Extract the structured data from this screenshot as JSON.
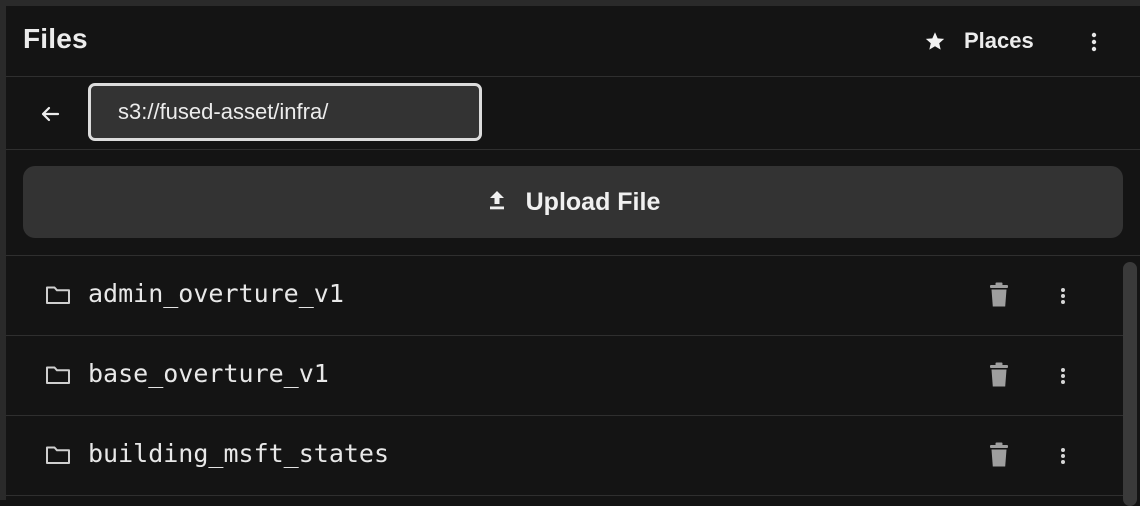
{
  "header": {
    "title": "Files",
    "places_label": "Places"
  },
  "pathbar": {
    "path_value": "s3://fused-asset/infra/"
  },
  "upload": {
    "label": "Upload File"
  },
  "files": [
    {
      "name": "admin_overture_v1",
      "type": "folder"
    },
    {
      "name": "base_overture_v1",
      "type": "folder"
    },
    {
      "name": "building_msft_states",
      "type": "folder"
    }
  ],
  "icons": {
    "places": "star-icon",
    "header_menu": "more-vert-icon",
    "back": "arrow-back-icon",
    "upload": "upload-icon",
    "folder": "folder-outline-icon",
    "delete": "trash-icon",
    "row_menu": "more-vert-icon"
  },
  "colors": {
    "background": "#141414",
    "surface": "#333333",
    "divider": "#2f2f2f",
    "text": "#ececec",
    "icon_muted": "#bdbdbd"
  }
}
